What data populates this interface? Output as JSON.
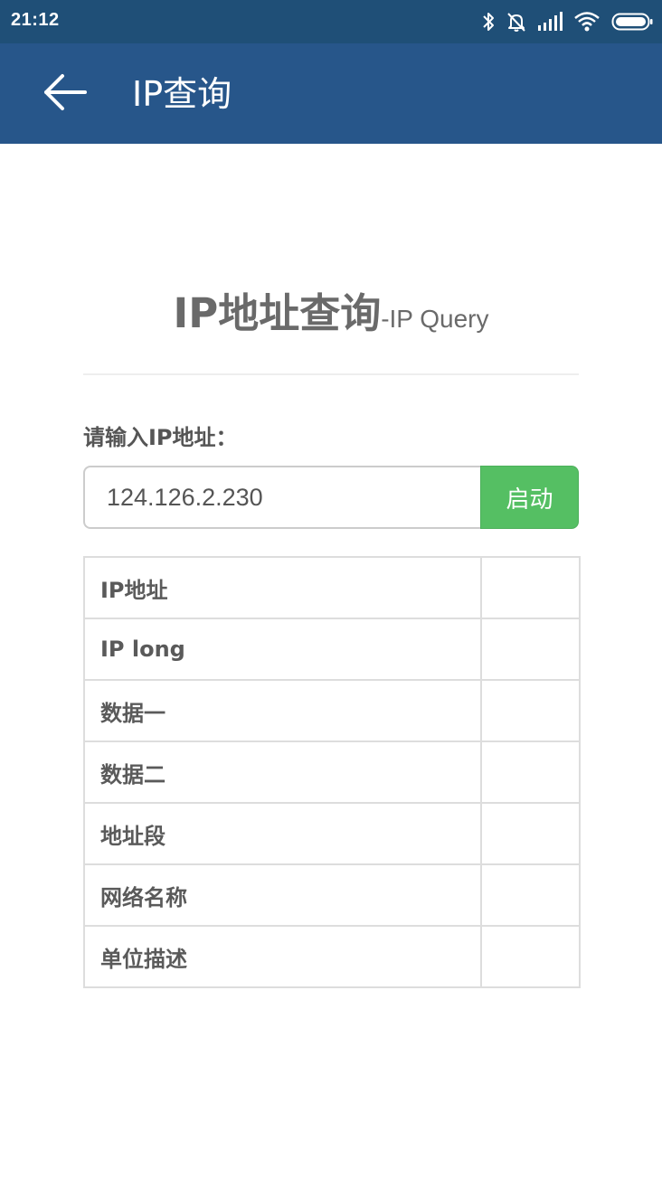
{
  "status_bar": {
    "time": "21:12",
    "icons": [
      "bluetooth-icon",
      "bell-off-icon",
      "signal-icon",
      "wifi-icon",
      "battery-icon"
    ]
  },
  "app_bar": {
    "back_icon": "arrow-left-icon",
    "title": "IP查询"
  },
  "heading": {
    "main": "IP地址查询",
    "sub": "-IP Query"
  },
  "form": {
    "label": "请输入IP地址：",
    "input_value": "124.126.2.230",
    "button_label": "启动"
  },
  "results": {
    "rows": [
      {
        "label": "IP地址",
        "value": ""
      },
      {
        "label": "IP long",
        "value": ""
      },
      {
        "label": "数据一",
        "value": ""
      },
      {
        "label": "数据二",
        "value": ""
      },
      {
        "label": "地址段",
        "value": ""
      },
      {
        "label": "网络名称",
        "value": ""
      },
      {
        "label": "单位描述",
        "value": ""
      }
    ]
  },
  "colors": {
    "status_bar": "#1f4f77",
    "app_bar": "#27568a",
    "button": "#55bf63",
    "text": "#6a6a6a"
  }
}
